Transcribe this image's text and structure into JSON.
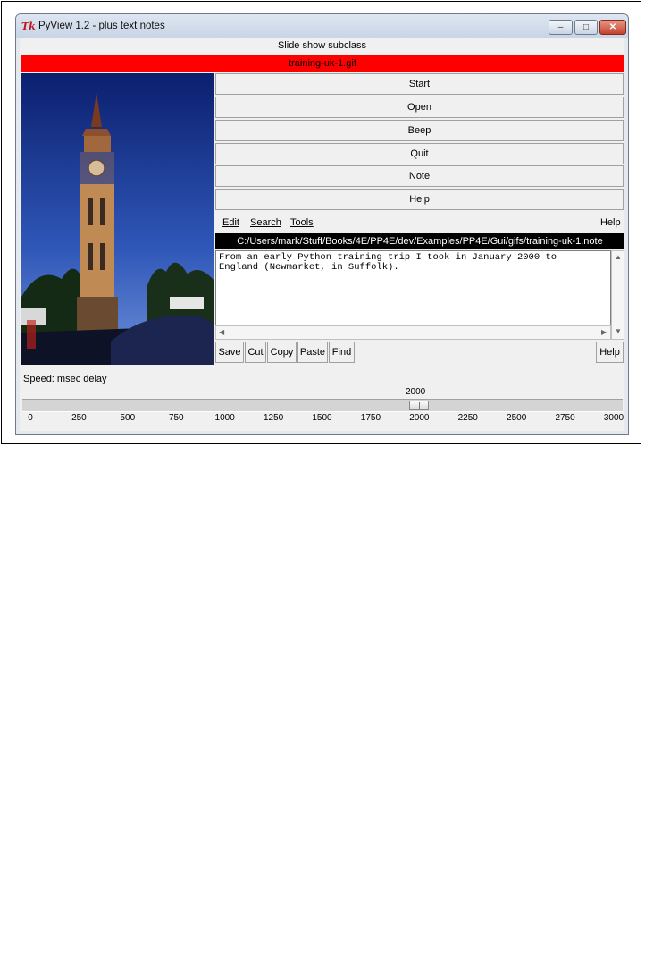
{
  "window": {
    "app_icon": "Tk",
    "title": "PyView 1.2 - plus text notes",
    "controls": {
      "minimize_icon": "–",
      "maximize_icon": "□",
      "close_icon": "✕"
    }
  },
  "main": {
    "subtitle": "Slide show subclass",
    "filename": "training-uk-1.gif",
    "buttons": [
      "Start",
      "Open",
      "Beep",
      "Quit",
      "Note",
      "Help"
    ]
  },
  "editor": {
    "menu": [
      "Edit",
      "Search",
      "Tools"
    ],
    "menu_help": "Help",
    "path": "C:/Users/mark/Stuff/Books/4E/PP4E/dev/Examples/PP4E/Gui/gifs/training-uk-1.note",
    "text_lines": [
      "From an early Python training trip I took in January 2000 to",
      "England (Newmarket, in Suffolk)."
    ],
    "toolbar": [
      "Save",
      "Cut",
      "Copy",
      "Paste",
      "Find"
    ],
    "toolbar_help": "Help"
  },
  "speed": {
    "label": "Speed: msec delay",
    "value": 2000,
    "value_text": "2000",
    "min": 0,
    "max": 3000,
    "ticks": [
      "0",
      "250",
      "500",
      "750",
      "1000",
      "1250",
      "1500",
      "1750",
      "2000",
      "2250",
      "2500",
      "2750",
      "3000"
    ]
  },
  "colors": {
    "filename_bar": "#ff0000",
    "path_bar": "#000000"
  }
}
